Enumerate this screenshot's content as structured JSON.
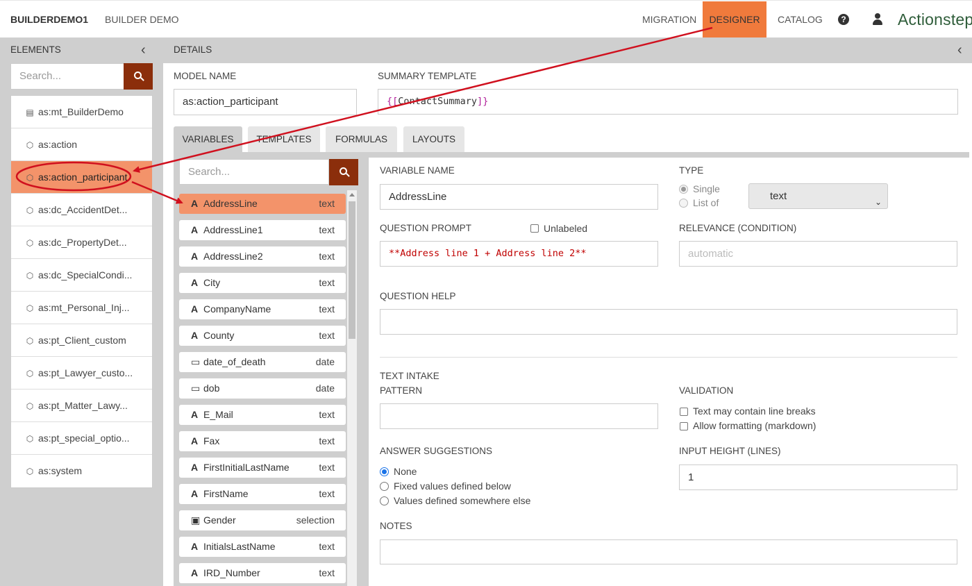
{
  "topbar": {
    "brand": "BUILDERDEMO1",
    "subtitle": "BUILDER DEMO",
    "nav": [
      "MIGRATION",
      "DESIGNER",
      "CATALOG"
    ],
    "active_nav": "DESIGNER",
    "help_glyph": "?",
    "logo": "Actionstep"
  },
  "elements": {
    "heading": "ELEMENTS",
    "search_placeholder": "Search...",
    "items": [
      {
        "label": "as:mt_BuilderDemo",
        "icon": "table-icon"
      },
      {
        "label": "as:action",
        "icon": "cube-icon"
      },
      {
        "label": "as:action_participant",
        "icon": "cube-icon"
      },
      {
        "label": "as:dc_AccidentDet...",
        "icon": "cube-icon"
      },
      {
        "label": "as:dc_PropertyDet...",
        "icon": "cube-icon"
      },
      {
        "label": "as:dc_SpecialCondi...",
        "icon": "cube-icon"
      },
      {
        "label": "as:mt_Personal_Inj...",
        "icon": "cube-icon"
      },
      {
        "label": "as:pt_Client_custom",
        "icon": "cube-icon"
      },
      {
        "label": "as:pt_Lawyer_custo...",
        "icon": "cube-icon"
      },
      {
        "label": "as:pt_Matter_Lawy...",
        "icon": "cube-icon"
      },
      {
        "label": "as:pt_special_optio...",
        "icon": "cube-icon"
      },
      {
        "label": "as:system",
        "icon": "cube-icon"
      }
    ],
    "active_index": 2
  },
  "details": {
    "heading": "DETAILS",
    "model_name_label": "MODEL NAME",
    "model_name": "as:action_participant",
    "summary_template_label": "SUMMARY TEMPLATE",
    "summary_template_open": "{[",
    "summary_template_body": "ContactSummary",
    "summary_template_close": "]}",
    "tabs": [
      "VARIABLES",
      "TEMPLATES",
      "FORMULAS",
      "LAYOUTS"
    ],
    "active_tab": "VARIABLES"
  },
  "variables": {
    "search_placeholder": "Search...",
    "items": [
      {
        "name": "AddressLine",
        "type": "text",
        "icon": "text-icon"
      },
      {
        "name": "AddressLine1",
        "type": "text",
        "icon": "text-icon"
      },
      {
        "name": "AddressLine2",
        "type": "text",
        "icon": "text-icon"
      },
      {
        "name": "City",
        "type": "text",
        "icon": "text-icon"
      },
      {
        "name": "CompanyName",
        "type": "text",
        "icon": "text-icon"
      },
      {
        "name": "County",
        "type": "text",
        "icon": "text-icon"
      },
      {
        "name": "date_of_death",
        "type": "date",
        "icon": "calendar-icon"
      },
      {
        "name": "dob",
        "type": "date",
        "icon": "calendar-icon"
      },
      {
        "name": "E_Mail",
        "type": "text",
        "icon": "text-icon"
      },
      {
        "name": "Fax",
        "type": "text",
        "icon": "text-icon"
      },
      {
        "name": "FirstInitialLastName",
        "type": "text",
        "icon": "text-icon"
      },
      {
        "name": "FirstName",
        "type": "text",
        "icon": "text-icon"
      },
      {
        "name": "Gender",
        "type": "selection",
        "icon": "selection-icon"
      },
      {
        "name": "InitialsLastName",
        "type": "text",
        "icon": "text-icon"
      },
      {
        "name": "IRD_Number",
        "type": "text",
        "icon": "text-icon"
      }
    ],
    "active_index": 0
  },
  "form": {
    "variable_name_label": "VARIABLE NAME",
    "variable_name": "AddressLine",
    "type_label": "TYPE",
    "type_single": "Single",
    "type_list": "List of",
    "type_value": "text",
    "question_prompt_label": "QUESTION PROMPT",
    "unlabeled": "Unlabeled",
    "question_prompt": "**Address line 1 + Address line 2**",
    "relevance_label": "RELEVANCE (CONDITION)",
    "relevance_placeholder": "automatic",
    "question_help_label": "QUESTION HELP",
    "question_help": "",
    "text_intake_label": "TEXT INTAKE",
    "pattern_label": "PATTERN",
    "pattern": "",
    "validation_label": "VALIDATION",
    "validation_line_breaks": "Text may contain line breaks",
    "validation_markdown": "Allow formatting (markdown)",
    "answer_suggestions_label": "ANSWER SUGGESTIONS",
    "answer_options": [
      "None",
      "Fixed values defined below",
      "Values defined somewhere else"
    ],
    "answer_selected": "None",
    "input_height_label": "INPUT HEIGHT (LINES)",
    "input_height": "1",
    "notes_label": "NOTES",
    "notes": ""
  },
  "colors": {
    "accent": "#f07a3c",
    "active_row": "#f3936a",
    "search_button": "#8b2e0b",
    "annotation": "#d0101e",
    "logo": "#2f5d3a"
  }
}
